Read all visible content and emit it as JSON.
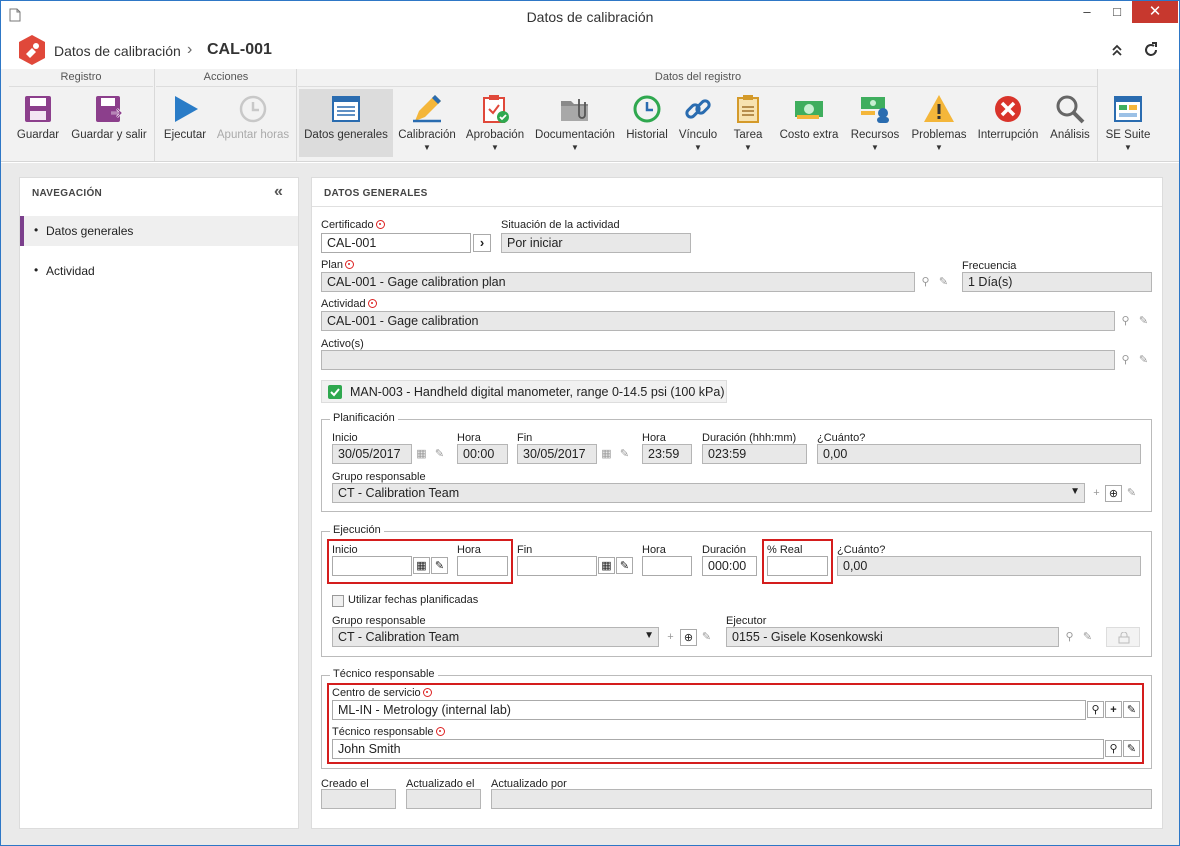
{
  "window": {
    "title": "Datos de calibración",
    "minimize": "‒",
    "maximize": "□",
    "close": "✕"
  },
  "header": {
    "breadcrumb_parent": "Datos de calibración",
    "separator": "›",
    "record_id": "CAL-001"
  },
  "ribbon": {
    "groups": {
      "registro": "Registro",
      "acciones": "Acciones",
      "datos": "Datos del registro"
    },
    "buttons": {
      "guardar": "Guardar",
      "guardar_salir": "Guardar y salir",
      "ejecutar": "Ejecutar",
      "apuntar": "Apuntar horas",
      "datos_generales": "Datos generales",
      "calibracion": "Calibración",
      "aprobacion": "Aprobación",
      "documentacion": "Documentación",
      "historial": "Historial",
      "vinculo": "Vínculo",
      "tarea": "Tarea",
      "costo_extra": "Costo extra",
      "recursos": "Recursos",
      "problemas": "Problemas",
      "interrupcion": "Interrupción",
      "analisis": "Análisis",
      "se_suite": "SE Suite"
    }
  },
  "nav": {
    "title": "NAVEGACIÓN",
    "items": [
      "Datos generales",
      "Actividad"
    ],
    "collapse": "«"
  },
  "form": {
    "title": "DATOS GENERALES",
    "certificado": {
      "label": "Certificado",
      "value": "CAL-001"
    },
    "situacion": {
      "label": "Situación de la actividad",
      "value": "Por iniciar"
    },
    "plan": {
      "label": "Plan",
      "value": "CAL-001 - Gage calibration plan"
    },
    "frecuencia": {
      "label": "Frecuencia",
      "value": "1 Día(s)"
    },
    "actividad": {
      "label": "Actividad",
      "value": "CAL-001 - Gage calibration"
    },
    "activos": {
      "label": "Activo(s)",
      "value": "",
      "item": "MAN-003 - Handheld digital manometer, range 0-14.5 psi (100 kPa)"
    },
    "planificacion": {
      "legend": "Planificación",
      "inicio_label": "Inicio",
      "inicio": "30/05/2017",
      "hora1_label": "Hora",
      "hora1": "00:00",
      "fin_label": "Fin",
      "fin": "30/05/2017",
      "hora2_label": "Hora",
      "hora2": "23:59",
      "duracion_label": "Duración (hhh:mm)",
      "duracion": "023:59",
      "cuanto_label": "¿Cuánto?",
      "cuanto": "0,00",
      "grupo_label": "Grupo responsable",
      "grupo": "CT - Calibration Team"
    },
    "ejecucion": {
      "legend": "Ejecución",
      "inicio_label": "Inicio",
      "hora1_label": "Hora",
      "fin_label": "Fin",
      "hora2_label": "Hora",
      "duracion_label": "Duración",
      "duracion": "000:00",
      "real_label": "% Real",
      "cuanto_label": "¿Cuánto?",
      "cuanto": "0,00",
      "usar_fechas": "Utilizar fechas planificadas",
      "grupo_label": "Grupo responsable",
      "grupo": "CT - Calibration Team",
      "ejecutor_label": "Ejecutor",
      "ejecutor": "0155 - Gisele Kosenkowski"
    },
    "tecnico": {
      "legend": "Técnico responsable",
      "centro_label": "Centro de servicio",
      "centro": "ML-IN - Metrology (internal lab)",
      "tecnico_label": "Técnico responsable",
      "tecnico": "John Smith"
    },
    "creado_label": "Creado el",
    "actualizado_label": "Actualizado el",
    "actualizado_por_label": "Actualizado por"
  },
  "colors": {
    "accent": "#2d7fd0",
    "required": "#d22222",
    "highlight": "#d41d1d",
    "check": "#2fa84f"
  }
}
